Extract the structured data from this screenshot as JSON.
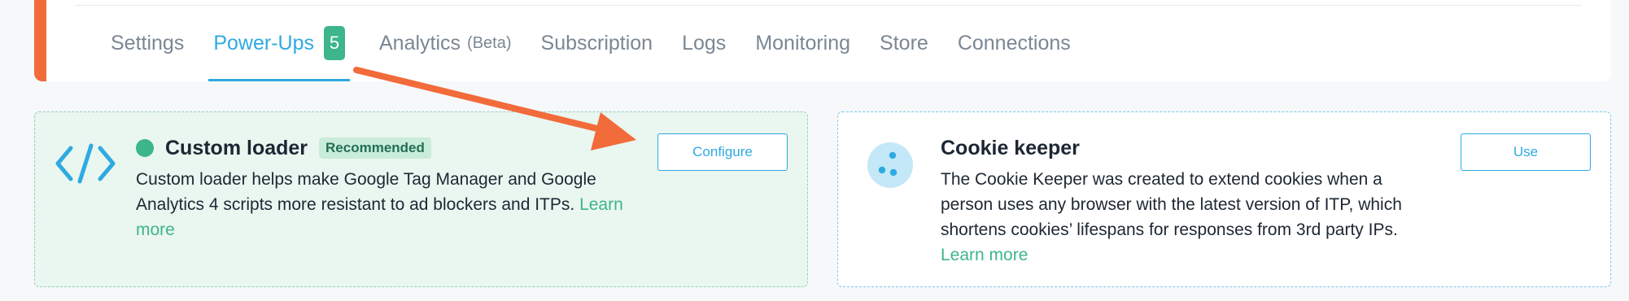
{
  "tabs": [
    {
      "label": "Settings"
    },
    {
      "label": "Power-Ups",
      "badge": "5",
      "active": true
    },
    {
      "label": "Analytics",
      "sub": "(Beta)"
    },
    {
      "label": "Subscription"
    },
    {
      "label": "Logs"
    },
    {
      "label": "Monitoring"
    },
    {
      "label": "Store"
    },
    {
      "label": "Connections"
    }
  ],
  "cards": {
    "custom_loader": {
      "title": "Custom loader",
      "badge": "Recommended",
      "description": "Custom loader helps make Google Tag Manager and Google Analytics 4 scripts more resistant to ad blockers and ITPs.",
      "learn_more": "Learn more",
      "button": "Configure",
      "icon": "code-icon",
      "status": "active"
    },
    "cookie_keeper": {
      "title": "Cookie keeper",
      "description": "The Cookie Keeper was created to extend cookies when a person uses any browser with the latest version of ITP, which shortens cookies’ lifespans for responses from 3rd party IPs.",
      "learn_more": "Learn more",
      "button": "Use",
      "icon": "cookie-icon"
    }
  },
  "colors": {
    "accent": "#2eaae1",
    "success": "#3cb68a",
    "annotation": "#f26b3a"
  }
}
